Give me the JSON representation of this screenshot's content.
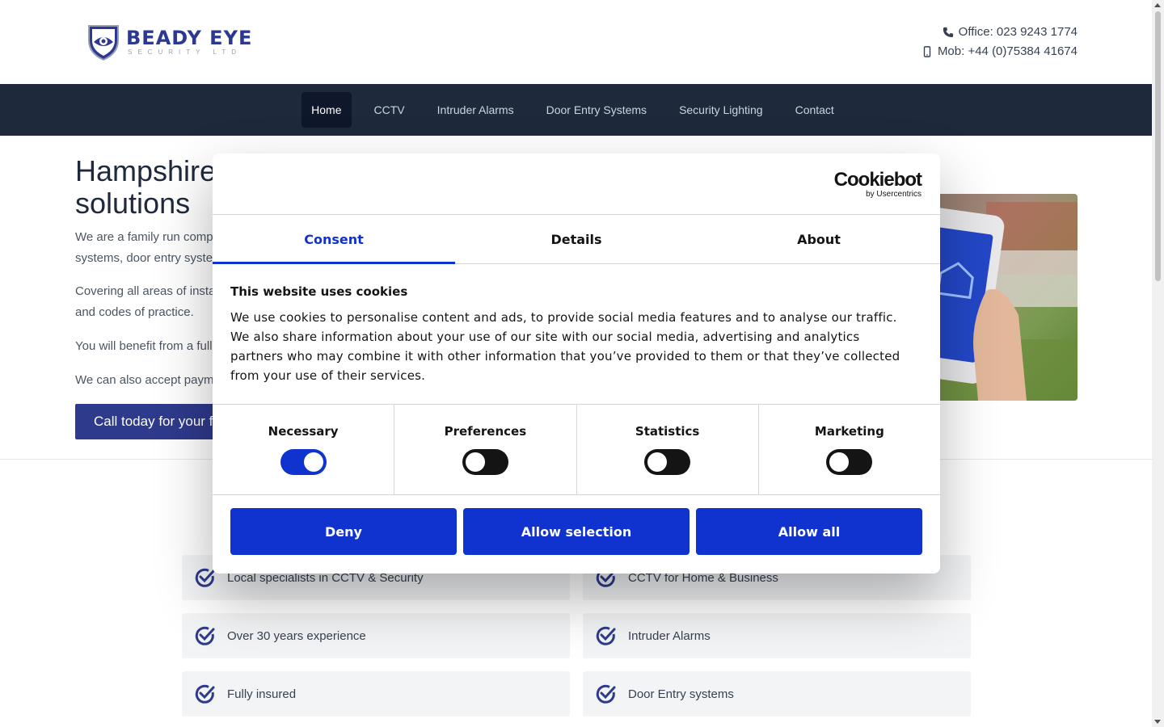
{
  "header": {
    "logo_name": "BEADY EYE",
    "logo_sub": "SECURITY LTD",
    "office": "Office: 023 9243 1774",
    "mobile": "Mob: +44 (0)75384 41674"
  },
  "nav": {
    "items": [
      "Home",
      "CCTV",
      "Intruder Alarms",
      "Door Entry Systems",
      "Security Lighting",
      "Contact"
    ],
    "active": "Home"
  },
  "hero": {
    "title_line1": "Hampshire",
    "title_line2": "solutions",
    "p1_line1": "We are a family run compa",
    "p1_line2": "systems, door entry syster",
    "p2_line1": "Covering all areas of insta",
    "p2_line2": "and codes of practice.",
    "p3": "You will benefit from a full",
    "p4": "We can also accept payme",
    "cta": "Call today for your f"
  },
  "features": [
    "Local specialists in CCTV & Security",
    "CCTV for Home & Business",
    "Over 30 years experience",
    "Intruder Alarms",
    "Fully insured",
    "Door Entry systems"
  ],
  "cookie": {
    "brand": "Cookiebot",
    "brand_by": "by Usercentrics",
    "tabs": [
      "Consent",
      "Details",
      "About"
    ],
    "active_tab": "Consent",
    "title": "This website uses cookies",
    "body": "We use cookies to personalise content and ads, to provide social media features and to analyse our traffic. We also share information about your use of our site with our social media, advertising and analytics partners who may combine it with other information that you’ve provided to them or that they’ve collected from your use of their services.",
    "toggles": [
      {
        "label": "Necessary",
        "on": true
      },
      {
        "label": "Preferences",
        "on": false
      },
      {
        "label": "Statistics",
        "on": false
      },
      {
        "label": "Marketing",
        "on": false
      }
    ],
    "buttons": {
      "deny": "Deny",
      "allow_selection": "Allow selection",
      "allow_all": "Allow all"
    }
  },
  "colors": {
    "brand": "#2b3990",
    "nav_bg": "#1e293b",
    "cookie_accent": "#1032cf"
  }
}
